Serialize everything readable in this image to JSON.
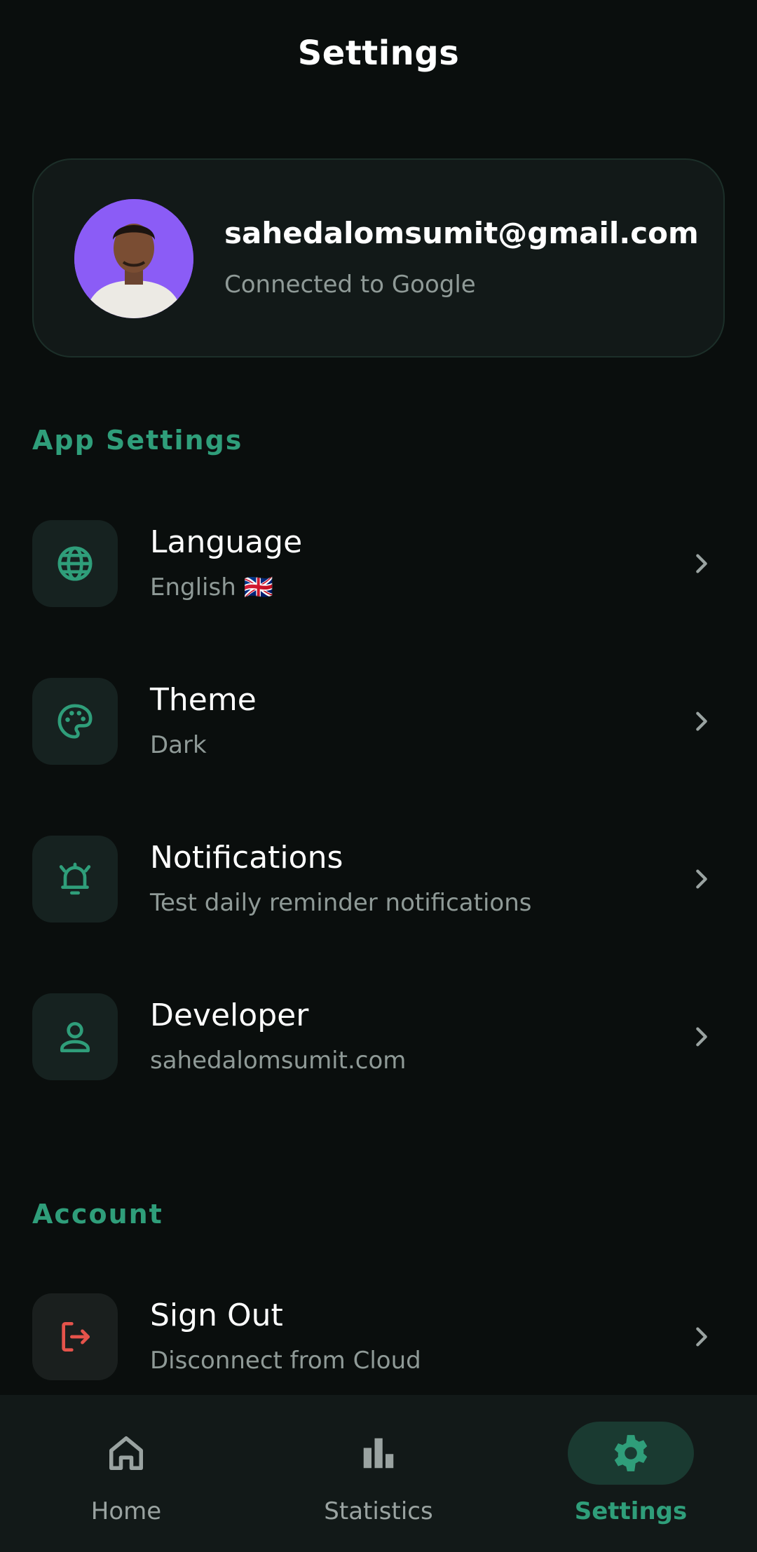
{
  "header": {
    "title": "Settings"
  },
  "profile": {
    "email": "sahedalomsumit@gmail.com",
    "status": "Connected to Google"
  },
  "sections": {
    "app_settings": {
      "label": "App Settings",
      "items": [
        {
          "title": "Language",
          "subtitle": "English 🇬🇧",
          "icon": "globe-icon"
        },
        {
          "title": "Theme",
          "subtitle": "Dark",
          "icon": "palette-icon"
        },
        {
          "title": "Notifications",
          "subtitle": "Test daily reminder notifications",
          "icon": "bell-ringing-icon"
        },
        {
          "title": "Developer",
          "subtitle": "sahedalomsumit.com",
          "icon": "person-icon"
        }
      ]
    },
    "account": {
      "label": "Account",
      "items": [
        {
          "title": "Sign Out",
          "subtitle": "Disconnect from Cloud",
          "icon": "logout-icon"
        }
      ]
    }
  },
  "nav": {
    "items": [
      {
        "label": "Home",
        "icon": "home-icon",
        "active": false
      },
      {
        "label": "Statistics",
        "icon": "bar-chart-icon",
        "active": false
      },
      {
        "label": "Settings",
        "icon": "gear-icon",
        "active": true
      }
    ]
  },
  "colors": {
    "background": "#0a0e0d",
    "card": "#121918",
    "accent": "#2f9e7a",
    "danger": "#e5534b",
    "muted_text": "#8f9a97"
  }
}
